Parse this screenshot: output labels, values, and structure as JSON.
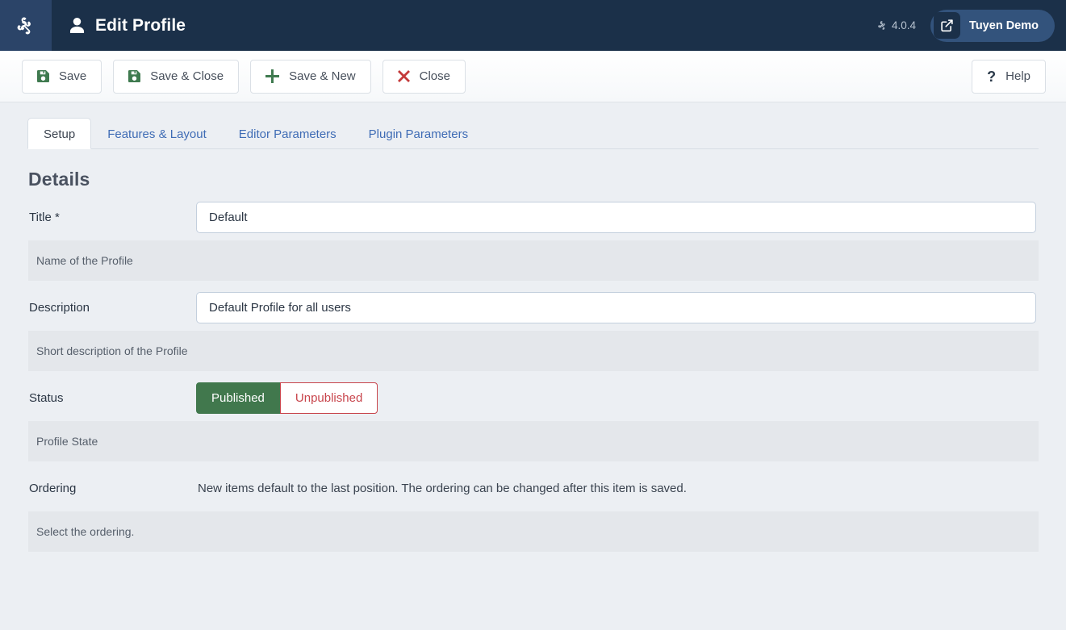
{
  "header": {
    "logo_icon": "joomla-logo-icon",
    "title_icon": "user-icon",
    "title": "Edit Profile",
    "version_icon": "joomla-mark-icon",
    "version": "4.0.4",
    "user_pill_icon": "external-link-icon",
    "user_pill_label": "Tuyen Demo"
  },
  "toolbar": {
    "save_icon": "floppy-disk-icon",
    "save_label": "Save",
    "save_close_icon": "floppy-disk-icon",
    "save_close_label": "Save & Close",
    "save_new_icon": "plus-icon",
    "save_new_label": "Save & New",
    "close_icon": "times-icon",
    "close_label": "Close",
    "help_icon": "question-mark-icon",
    "help_label": "Help"
  },
  "tabs": [
    {
      "label": "Setup",
      "active": true
    },
    {
      "label": "Features & Layout",
      "active": false
    },
    {
      "label": "Editor Parameters",
      "active": false
    },
    {
      "label": "Plugin Parameters",
      "active": false
    }
  ],
  "main": {
    "section_title": "Details",
    "fields": {
      "title": {
        "label": "Title *",
        "value": "Default",
        "placeholder": "",
        "help": "Name of the Profile"
      },
      "description": {
        "label": "Description",
        "value": "Default Profile for all users",
        "placeholder": "",
        "help": "Short description of the Profile"
      },
      "status": {
        "label": "Status",
        "published_label": "Published",
        "unpublished_label": "Unpublished",
        "selected": "Published",
        "help": "Profile State"
      },
      "ordering": {
        "label": "Ordering",
        "note": "New items default to the last position. The ordering can be changed after this item is saved.",
        "help": "Select the ordering."
      }
    }
  },
  "colors": {
    "header_bg": "#1b3049",
    "brand_bg": "#2b4468",
    "page_bg": "#eceff3",
    "accent_link": "#3f6cb5",
    "success": "#41784d",
    "danger": "#c8454c",
    "help_band": "#e4e7eb"
  }
}
